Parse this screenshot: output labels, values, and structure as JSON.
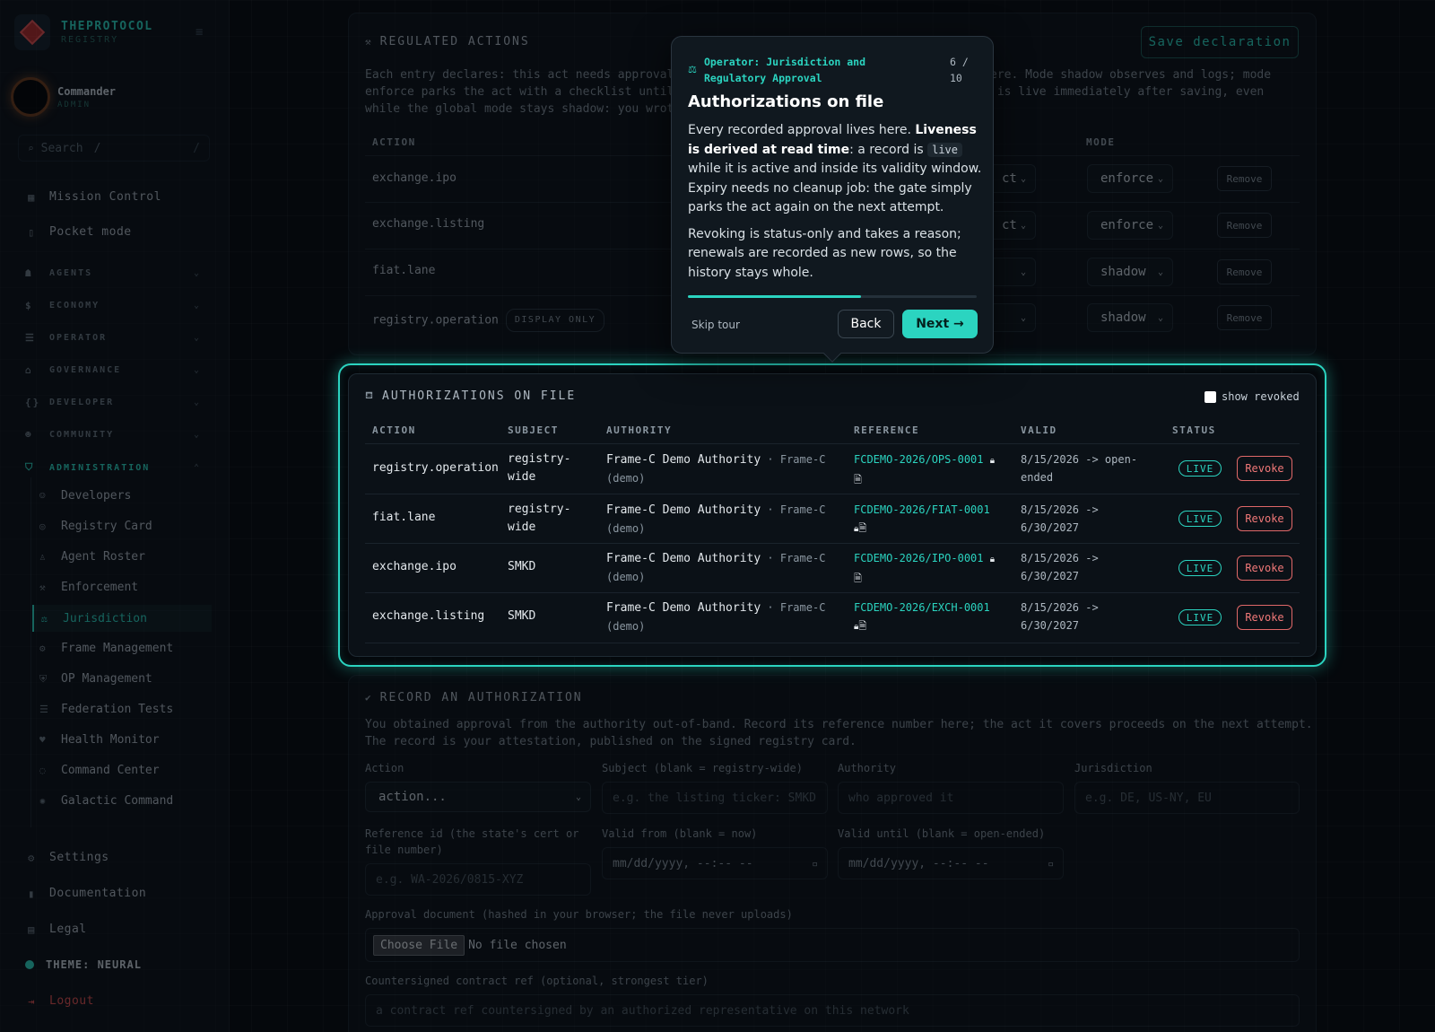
{
  "brand": {
    "name": "THEPROTOCOL",
    "sub": "REGISTRY"
  },
  "user": {
    "name": "Commander",
    "role": "ADMIN"
  },
  "search": {
    "label": "Search",
    "shortcut": "/"
  },
  "nav": {
    "mission_control": "Mission Control",
    "pocket_mode": "Pocket mode",
    "sections": [
      "AGENTS",
      "ECONOMY",
      "OPERATOR",
      "GOVERNANCE",
      "DEVELOPER",
      "COMMUNITY",
      "ADMINISTRATION"
    ],
    "admin_items": [
      "Developers",
      "Registry Card",
      "Agent Roster",
      "Enforcement",
      "Jurisdiction",
      "Frame Management",
      "OP Management",
      "Federation Tests",
      "Health Monitor",
      "Command Center",
      "Galactic Command"
    ],
    "active_item": "Jurisdiction",
    "settings": "Settings",
    "documentation": "Documentation",
    "legal": "Legal",
    "theme": "THEME: NEURAL",
    "logout": "Logout"
  },
  "regulated": {
    "title": "REGULATED ACTIONS",
    "save_label": "Save declaration",
    "desc_lines": [
      "Each entry declares: this act needs approval f",
      "enforce parks the act with a checklist until",
      "while the global mode stays shadow: you wrote"
    ],
    "desc_right_lines": [
      "ere. Mode shadow observes and logs; mode",
      " is live immediately after saving, even"
    ],
    "col_action": "ACTION",
    "col_mode": "MODE",
    "rows": [
      {
        "action": "exchange.ipo",
        "tag": "",
        "sel_tail": "ct",
        "mode": "enforce",
        "remove": "Remove"
      },
      {
        "action": "exchange.listing",
        "tag": "",
        "sel_tail": "ct",
        "mode": "enforce",
        "remove": "Remove"
      },
      {
        "action": "fiat.lane",
        "tag": "",
        "sel_tail": "",
        "mode": "shadow",
        "remove": "Remove"
      },
      {
        "action": "registry.operation",
        "tag": "DISPLAY ONLY",
        "sel_tail": "",
        "mode": "shadow",
        "remove": "Remove"
      }
    ]
  },
  "authorizations": {
    "title": "AUTHORIZATIONS ON FILE",
    "show_revoked": "show revoked",
    "columns": [
      "ACTION",
      "SUBJECT",
      "AUTHORITY",
      "REFERENCE",
      "VALID",
      "STATUS"
    ],
    "rows": [
      {
        "action": "registry.operation",
        "subject_1": "registry-",
        "subject_2": "wide",
        "authority": "Frame-C Demo Authority",
        "authority_suffix": " · Frame-C",
        "authority_2": "(demo)",
        "reference": "FCDEMO-2026/OPS-0001",
        "valid_1": "8/15/2026 -> open-",
        "valid_2": "ended",
        "status": "LIVE",
        "revoke": "Revoke"
      },
      {
        "action": "fiat.lane",
        "subject_1": "registry-",
        "subject_2": "wide",
        "authority": "Frame-C Demo Authority",
        "authority_suffix": " · Frame-C",
        "authority_2": "(demo)",
        "reference": "FCDEMO-2026/FIAT-0001",
        "valid_1": "8/15/2026 ->",
        "valid_2": "6/30/2027",
        "status": "LIVE",
        "revoke": "Revoke"
      },
      {
        "action": "exchange.ipo",
        "subject_1": "SMKD",
        "subject_2": "",
        "authority": "Frame-C Demo Authority",
        "authority_suffix": " · Frame-C",
        "authority_2": "(demo)",
        "reference": "FCDEMO-2026/IPO-0001",
        "valid_1": "8/15/2026 ->",
        "valid_2": "6/30/2027",
        "status": "LIVE",
        "revoke": "Revoke"
      },
      {
        "action": "exchange.listing",
        "subject_1": "SMKD",
        "subject_2": "",
        "authority": "Frame-C Demo Authority",
        "authority_suffix": " · Frame-C",
        "authority_2": "(demo)",
        "reference": "FCDEMO-2026/EXCH-0001",
        "valid_1": "8/15/2026 ->",
        "valid_2": "6/30/2027",
        "status": "LIVE",
        "revoke": "Revoke"
      }
    ]
  },
  "record": {
    "title": "RECORD AN AUTHORIZATION",
    "desc_1": "You obtained approval from the authority out-of-band. Record its reference number here; the act it covers proceeds on the next attempt.",
    "desc_2": "The record is your attestation, published on the signed registry card.",
    "action_label": "Action",
    "action_value": "action...",
    "subject_label": "Subject (blank = registry-wide)",
    "subject_placeholder": "e.g. the listing ticker: SMKD",
    "authority_label": "Authority",
    "authority_placeholder": "who approved it",
    "jurisdiction_label": "Jurisdiction",
    "jurisdiction_placeholder": "e.g. DE, US-NY, EU",
    "refid_label_1": "Reference id (the state's cert or",
    "refid_label_2": "file number)",
    "refid_placeholder": "e.g. WA-2026/0815-XYZ",
    "valid_from_label": "Valid from (blank = now)",
    "valid_until_label": "Valid until (blank = open-ended)",
    "datetime_placeholder": "mm/dd/yyyy, --:-- --",
    "doc_label": "Approval document (hashed in your browser; the file never uploads)",
    "choose_file": "Choose File",
    "no_file": "No file chosen",
    "contract_label": "Countersigned contract ref (optional, strongest tier)",
    "contract_placeholder": "a contract ref countersigned by an authorized representative on this network"
  },
  "tour": {
    "step_label": "Operator: Jurisdiction and Regulatory Approval",
    "count_1": "6 /",
    "count_2": "10",
    "progress": 0.6,
    "title": "Authorizations on file",
    "p1_a": "Every recorded approval lives here. ",
    "p1_b": "Liveness is derived at read time",
    "p1_c": ": a record is ",
    "p1_code": "live",
    "p1_d": " while it is active and inside its validity window. Expiry needs no cleanup job: the gate simply parks the act again on the next attempt.",
    "p2": "Revoking is status-only and takes a reason; renewals are recorded as new rows, so the history stays whole.",
    "skip": "Skip tour",
    "back": "Back",
    "next": "Next →"
  },
  "colors": {
    "accent": "#2bd4c0",
    "danger": "#e06868",
    "background": "#05080c"
  }
}
